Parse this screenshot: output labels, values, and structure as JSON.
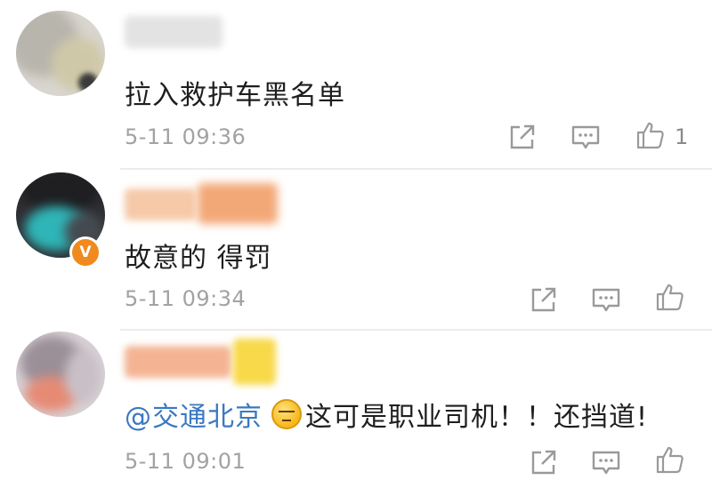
{
  "comments": [
    {
      "text": "拉入救护车黑名单",
      "time": "5-11 09:36",
      "likes": "1",
      "verified": false
    },
    {
      "text": "故意的 得罚",
      "time": "5-11 09:34",
      "likes": "",
      "verified": true,
      "verified_badge": "V"
    },
    {
      "mention": "@交通北京",
      "emoji": "awkward-face-emoji",
      "text": "这可是职业司机！！还挡道!",
      "time": "5-11 09:01",
      "likes": "",
      "verified": false
    }
  ],
  "icons": {
    "share": "share-icon",
    "reply": "comment-icon",
    "like": "thumbs-up-icon"
  },
  "colors": {
    "mention": "#3a78c2",
    "time": "#a2a2a2",
    "icon": "#9a9a9a",
    "verified_badge": "#f08a1e",
    "divider": "#ececec"
  }
}
